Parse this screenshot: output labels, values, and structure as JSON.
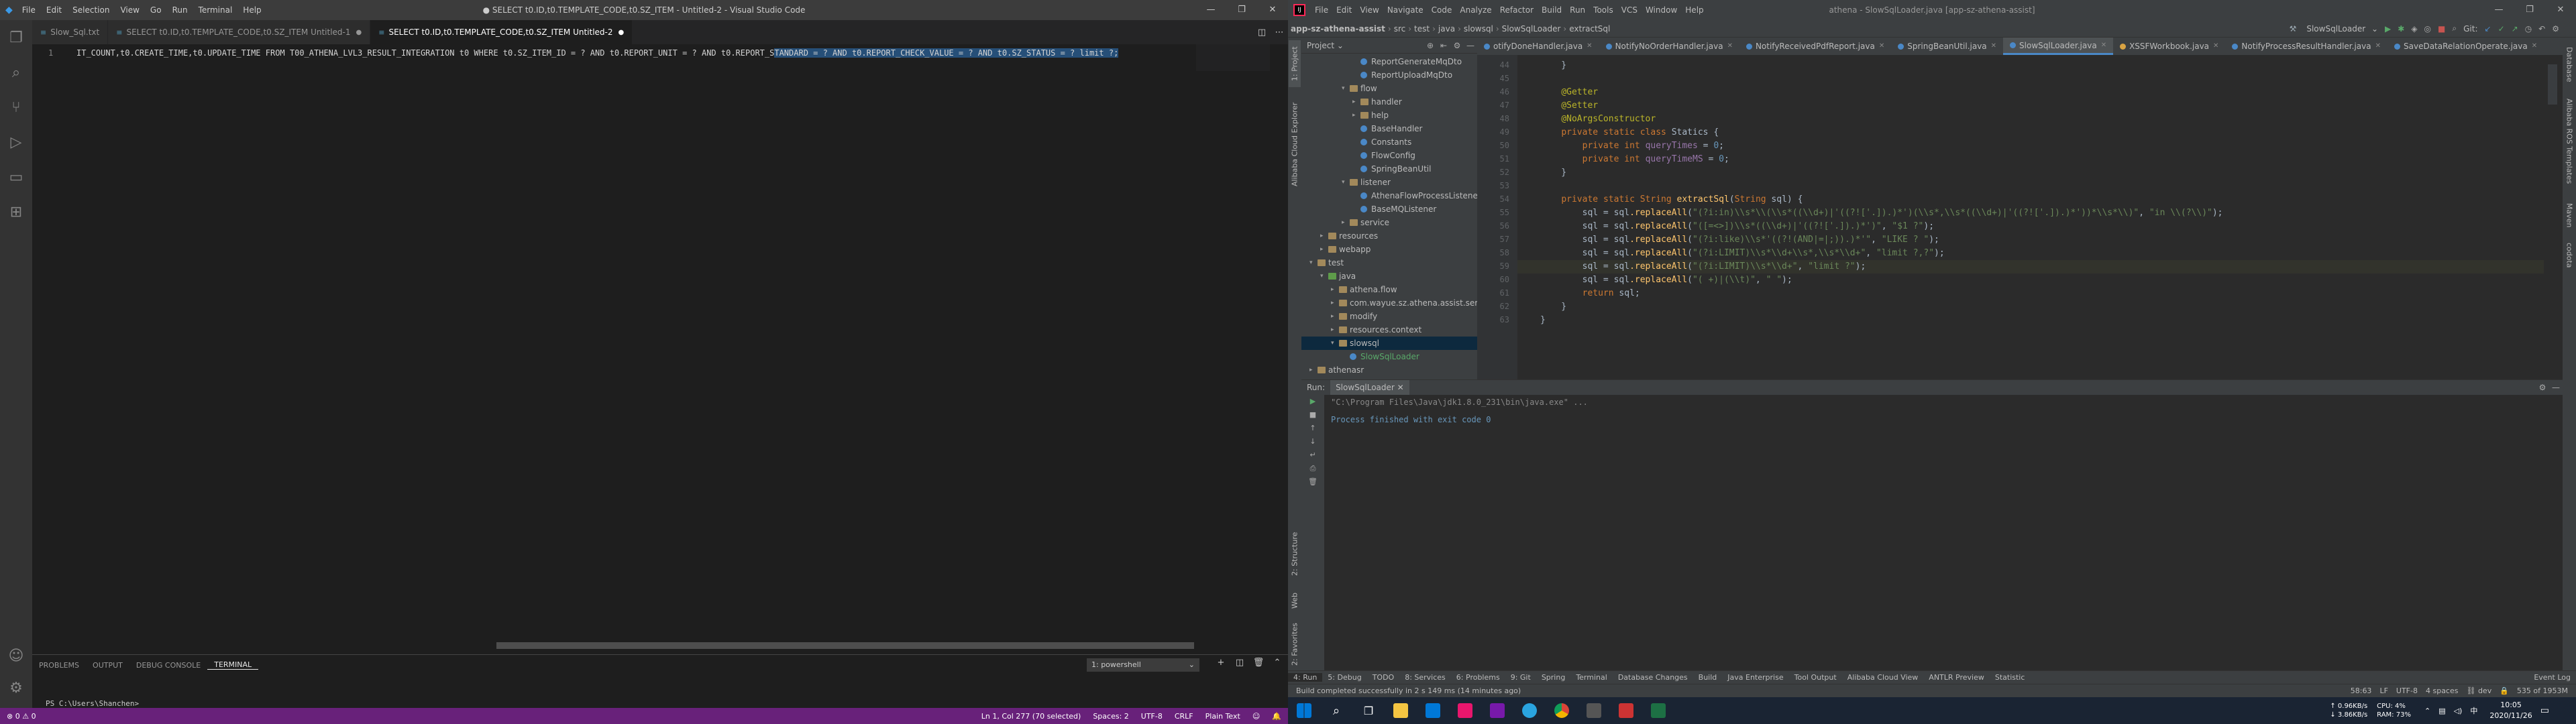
{
  "vscode": {
    "window_title": "● SELECT t0.ID,t0.TEMPLATE_CODE,t0.SZ_ITEM - Untitled-2 - Visual Studio Code",
    "menu": [
      "File",
      "Edit",
      "Selection",
      "View",
      "Go",
      "Run",
      "Terminal",
      "Help"
    ],
    "tabs": [
      {
        "label": "Slow_Sql.txt",
        "dirty": false,
        "active": false
      },
      {
        "label": "SELECT t0.ID,t0.TEMPLATE_CODE,t0.SZ_ITEM  Untitled-1",
        "dirty": true,
        "active": false
      },
      {
        "label": "SELECT t0.ID,t0.TEMPLATE_CODE,t0.SZ_ITEM  Untitled-2",
        "dirty": true,
        "active": true
      }
    ],
    "editor": {
      "line_number": "1",
      "code_before": "IT_COUNT,t0.CREATE_TIME,t0.UPDATE_TIME FROM T00_ATHENA_LVL3_RESULT_INTEGRATION t0 WHERE t0.SZ_ITEM_ID = ? AND t0.REPORT_UNIT = ? AND t0.REPORT_S",
      "code_selected": "TANDARD = ? AND t0.REPORT_CHECK_VALUE = ? AND t0.SZ_STATUS = ? limit ?;"
    },
    "panel_tabs": [
      "PROBLEMS",
      "OUTPUT",
      "DEBUG CONSOLE",
      "TERMINAL"
    ],
    "active_panel_tab": "TERMINAL",
    "terminal_select": "1: powershell",
    "terminal_prompt": "PS C:\\Users\\Shanchen>",
    "status_left": "⊗ 0 ⚠ 0",
    "status_right": [
      "Ln 1, Col 277 (70 selected)",
      "Spaces: 2",
      "UTF-8",
      "CRLF",
      "Plain Text",
      "☺",
      "🔔"
    ]
  },
  "idea": {
    "window_title": "athena - SlowSqlLoader.java [app-sz-athena-assist]",
    "menu": [
      "File",
      "Edit",
      "View",
      "Navigate",
      "Code",
      "Analyze",
      "Refactor",
      "Build",
      "Run",
      "Tools",
      "VCS",
      "Window",
      "Help"
    ],
    "breadcrumb": [
      "app-sz-athena-assist",
      "src",
      "test",
      "java",
      "slowsql",
      "SlowSqlLoader",
      "extractSql"
    ],
    "run_config": "SlowSqlLoader",
    "left_strip": [
      "1: Project",
      "Alibaba Cloud Explorer",
      "2: Structure",
      "Web",
      "2: Favorites"
    ],
    "right_strip": [
      "Database",
      "Alibaba ROS Templates",
      "Maven",
      "codota"
    ],
    "project_header": "Project",
    "tree": [
      {
        "label": "ReportGenerateMqDto",
        "depth": 5,
        "type": "class"
      },
      {
        "label": "ReportUploadMqDto",
        "depth": 5,
        "type": "class"
      },
      {
        "label": "flow",
        "depth": 4,
        "type": "folder",
        "open": true
      },
      {
        "label": "handler",
        "depth": 5,
        "type": "folder",
        "open": false
      },
      {
        "label": "help",
        "depth": 5,
        "type": "folder",
        "open": false
      },
      {
        "label": "BaseHandler",
        "depth": 5,
        "type": "class"
      },
      {
        "label": "Constants",
        "depth": 5,
        "type": "class"
      },
      {
        "label": "FlowConfig",
        "depth": 5,
        "type": "class"
      },
      {
        "label": "SpringBeanUtil",
        "depth": 5,
        "type": "class"
      },
      {
        "label": "listener",
        "depth": 4,
        "type": "folder",
        "open": true
      },
      {
        "label": "AthenaFlowProcessListener",
        "depth": 5,
        "type": "class"
      },
      {
        "label": "BaseMQListener",
        "depth": 5,
        "type": "class"
      },
      {
        "label": "service",
        "depth": 4,
        "type": "folder",
        "open": false
      },
      {
        "label": "resources",
        "depth": 2,
        "type": "folder",
        "open": false
      },
      {
        "label": "webapp",
        "depth": 2,
        "type": "folder",
        "open": false
      },
      {
        "label": "test",
        "depth": 1,
        "type": "folder",
        "open": true
      },
      {
        "label": "java",
        "depth": 2,
        "type": "srcfolder",
        "open": true
      },
      {
        "label": "athena.flow",
        "depth": 3,
        "type": "folder",
        "open": false
      },
      {
        "label": "com.wayue.sz.athena.assist.service.imp",
        "depth": 3,
        "type": "folder",
        "open": false
      },
      {
        "label": "modify",
        "depth": 3,
        "type": "folder",
        "open": false
      },
      {
        "label": "resources.context",
        "depth": 3,
        "type": "folder",
        "open": false
      },
      {
        "label": "slowsql",
        "depth": 3,
        "type": "folder",
        "open": true,
        "selected": true
      },
      {
        "label": "SlowSqlLoader",
        "depth": 4,
        "type": "class"
      },
      {
        "label": "athenasr",
        "depth": 1,
        "type": "folder",
        "open": false
      }
    ],
    "editor_tabs": [
      {
        "label": "otifyDoneHandler.java",
        "color": "#4a88c7"
      },
      {
        "label": "NotifyNoOrderHandler.java",
        "color": "#4a88c7"
      },
      {
        "label": "NotifyReceivedPdfReport.java",
        "color": "#4a88c7"
      },
      {
        "label": "SpringBeanUtil.java",
        "color": "#4a88c7"
      },
      {
        "label": "SlowSqlLoader.java",
        "color": "#4a88c7",
        "active": true
      },
      {
        "label": "XSSFWorkbook.java",
        "color": "#d9a343"
      },
      {
        "label": "NotifyProcessResultHandler.java",
        "color": "#4a88c7"
      },
      {
        "label": "SaveDataRelationOperate.java",
        "color": "#4a88c7"
      }
    ],
    "line_numbers": [
      "44",
      "45",
      "46",
      "47",
      "48",
      "49",
      "50",
      "51",
      "52",
      "53",
      "54",
      "55",
      "56",
      "57",
      "58",
      "59",
      "60",
      "61",
      "62",
      "63"
    ],
    "code_lines": [
      "    }",
      "",
      "    @Getter",
      "    @Setter",
      "    @NoArgsConstructor",
      "    private static class Statics {",
      "        private int queryTimes = 0;",
      "        private int queryTimeMS = 0;",
      "    }",
      "",
      "    private static String extractSql(String sql) {",
      "        sql = sql.replaceAll(\"(?i:in)\\\\s*\\\\(\\\\s*((\\\\d+)|'((?!['.]).)*')(\\\\s*,\\\\s*((\\\\d+)|'((?!['.]).)*'))*\\\\s*\\\\)\", \"in \\\\(?\\\\)\");",
      "        sql = sql.replaceAll(\"([=<>])\\\\s*((\\\\d+)|'((?!['.]).)*')\", \"$1 ?\");",
      "        sql = sql.replaceAll(\"(?i:like)\\\\s*'((?!(AND|=|;)).)*'\", \"LIKE ? \");",
      "        sql = sql.replaceAll(\"(?i:LIMIT)\\\\s*\\\\d+\\\\s*,\\\\s*\\\\d+\", \"limit ?,?\");",
      "        sql = sql.replaceAll(\"(?i:LIMIT)\\\\s*\\\\d+\", \"limit ?\");",
      "        sql = sql.replaceAll(\"( +)|(\\\\t)\", \" \");",
      "        return sql;",
      "    }",
      "}"
    ],
    "run": {
      "label": "Run:",
      "tab": "SlowSqlLoader",
      "cmd": "\"C:\\Program Files\\Java\\jdk1.8.0_231\\bin\\java.exe\" ...",
      "exit": "Process finished with exit code 0"
    },
    "bottom_tabs": [
      "4: Run",
      "5: Debug",
      "TODO",
      "8: Services",
      "6: Problems",
      "9: Git",
      "Spring",
      "Terminal",
      "Database Changes",
      "Build",
      "Java Enterprise",
      "Tool Output",
      "Alibaba Cloud View",
      "ANTLR Preview",
      "Statistic"
    ],
    "event_log": "Event Log",
    "status_msg": "Build completed successfully in 2 s 149 ms (14 minutes ago)",
    "status_right": [
      "58:63",
      "LF",
      "UTF-8",
      "4 spaces",
      "⛓ dev",
      "🔒",
      "535 of 1953M"
    ]
  },
  "taskbar": {
    "net_up": "↑ 0.96KB/s",
    "net_down": "↓ 3.86KB/s",
    "cpu": "CPU: 4%",
    "ram": "RAM: 73%",
    "time": "10:05",
    "date": "2020/11/26"
  }
}
